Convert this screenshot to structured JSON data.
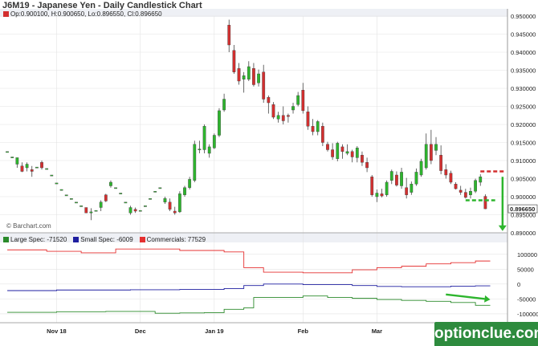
{
  "title": "J6M19 - Japanese Yen - Daily Candlestick Chart",
  "ohlc_text": "Op:0.900100, H:0.900650, Lo:0.896550, Cl:0.896650",
  "copyright": "© Barchart.com",
  "watermark": "optionclue.com",
  "last_price_label": "0.896650",
  "colors": {
    "up": "#2db52d",
    "down": "#d32f2f",
    "large": "#2a8a2a",
    "small": "#1f1fa0",
    "commercials": "#e53030",
    "accent": "#2e8b3e",
    "grid": "#e3e3e3"
  },
  "legend": [
    {
      "name": "Large Spec: -71520",
      "color": "#2a8a2a"
    },
    {
      "name": "Small Spec: -6009",
      "color": "#1f1fa0"
    },
    {
      "name": "Commercials: 77529",
      "color": "#e53030"
    }
  ],
  "chart_data": [
    {
      "type": "candlestick",
      "title": "J6M19 - Japanese Yen - Daily Candlestick Chart",
      "ylim": [
        0.89,
        0.95
      ],
      "yticks": [
        "0.950000",
        "0.945000",
        "0.940000",
        "0.935000",
        "0.930000",
        "0.925000",
        "0.920000",
        "0.915000",
        "0.910000",
        "0.905000",
        "0.900000",
        "0.895000",
        "0.890000"
      ],
      "yticks_values": [
        0.95,
        0.945,
        0.94,
        0.935,
        0.93,
        0.925,
        0.92,
        0.915,
        0.91,
        0.905,
        0.9,
        0.895,
        0.89
      ],
      "xticks": [
        "Nov 18",
        "Dec",
        "Jan 19",
        "Feb",
        "Mar"
      ],
      "xtick_index": [
        10,
        27,
        42,
        60,
        75
      ],
      "num_bars": 102,
      "candles": [
        {
          "i": 0,
          "o": 0.9125,
          "h": 0.9125,
          "l": 0.9125,
          "c": 0.9125
        },
        {
          "i": 1,
          "o": 0.911,
          "h": 0.911,
          "l": 0.911,
          "c": 0.911
        },
        {
          "i": 2,
          "o": 0.909,
          "h": 0.9105,
          "l": 0.908,
          "c": 0.9108
        },
        {
          "i": 3,
          "o": 0.9085,
          "h": 0.9095,
          "l": 0.9068,
          "c": 0.907
        },
        {
          "i": 4,
          "o": 0.908,
          "h": 0.9095,
          "l": 0.907,
          "c": 0.909
        },
        {
          "i": 5,
          "o": 0.9075,
          "h": 0.9085,
          "l": 0.9055,
          "c": 0.907
        },
        {
          "i": 6,
          "o": 0.9082,
          "h": 0.9082,
          "l": 0.9082,
          "c": 0.9082
        },
        {
          "i": 7,
          "o": 0.9095,
          "h": 0.91,
          "l": 0.9075,
          "c": 0.908
        },
        {
          "i": 8,
          "o": 0.9078,
          "h": 0.9078,
          "l": 0.9078,
          "c": 0.9078
        },
        {
          "i": 9,
          "o": 0.906,
          "h": 0.906,
          "l": 0.906,
          "c": 0.906
        },
        {
          "i": 10,
          "o": 0.9038,
          "h": 0.9038,
          "l": 0.9038,
          "c": 0.9038
        },
        {
          "i": 11,
          "o": 0.902,
          "h": 0.902,
          "l": 0.902,
          "c": 0.902
        },
        {
          "i": 12,
          "o": 0.9005,
          "h": 0.9005,
          "l": 0.9005,
          "c": 0.9005
        },
        {
          "i": 13,
          "o": 0.8995,
          "h": 0.8995,
          "l": 0.8995,
          "c": 0.8995
        },
        {
          "i": 14,
          "o": 0.8985,
          "h": 0.8985,
          "l": 0.8985,
          "c": 0.8985
        },
        {
          "i": 15,
          "o": 0.8975,
          "h": 0.8975,
          "l": 0.8975,
          "c": 0.8975
        },
        {
          "i": 16,
          "o": 0.897,
          "h": 0.897,
          "l": 0.8955,
          "c": 0.8955
        },
        {
          "i": 17,
          "o": 0.8955,
          "h": 0.8968,
          "l": 0.8935,
          "c": 0.8958
        },
        {
          "i": 18,
          "o": 0.8962,
          "h": 0.8962,
          "l": 0.8962,
          "c": 0.8962
        },
        {
          "i": 19,
          "o": 0.897,
          "h": 0.899,
          "l": 0.896,
          "c": 0.8985
        },
        {
          "i": 20,
          "o": 0.9005,
          "h": 0.9008,
          "l": 0.8985,
          "c": 0.8988
        },
        {
          "i": 21,
          "o": 0.903,
          "h": 0.9045,
          "l": 0.9025,
          "c": 0.904
        },
        {
          "i": 22,
          "o": 0.9025,
          "h": 0.9025,
          "l": 0.9025,
          "c": 0.9025
        },
        {
          "i": 23,
          "o": 0.901,
          "h": 0.901,
          "l": 0.901,
          "c": 0.901
        },
        {
          "i": 24,
          "o": 0.8985,
          "h": 0.8985,
          "l": 0.8985,
          "c": 0.8985
        },
        {
          "i": 25,
          "o": 0.8955,
          "h": 0.8975,
          "l": 0.895,
          "c": 0.897
        },
        {
          "i": 26,
          "o": 0.8965,
          "h": 0.897,
          "l": 0.8955,
          "c": 0.896
        },
        {
          "i": 27,
          "o": 0.8962,
          "h": 0.8962,
          "l": 0.8962,
          "c": 0.8962
        },
        {
          "i": 28,
          "o": 0.8975,
          "h": 0.8975,
          "l": 0.8975,
          "c": 0.8975
        },
        {
          "i": 29,
          "o": 0.8995,
          "h": 0.8995,
          "l": 0.8995,
          "c": 0.8995
        },
        {
          "i": 30,
          "o": 0.9015,
          "h": 0.9015,
          "l": 0.9015,
          "c": 0.9015
        },
        {
          "i": 31,
          "o": 0.9025,
          "h": 0.9025,
          "l": 0.9025,
          "c": 0.9025
        },
        {
          "i": 32,
          "o": 0.8985,
          "h": 0.9,
          "l": 0.898,
          "c": 0.8995
        },
        {
          "i": 33,
          "o": 0.8985,
          "h": 0.8995,
          "l": 0.896,
          "c": 0.8965
        },
        {
          "i": 34,
          "o": 0.896,
          "h": 0.8972,
          "l": 0.895,
          "c": 0.8955
        },
        {
          "i": 35,
          "o": 0.8958,
          "h": 0.9015,
          "l": 0.8955,
          "c": 0.9008
        },
        {
          "i": 36,
          "o": 0.9005,
          "h": 0.903,
          "l": 0.9,
          "c": 0.9025
        },
        {
          "i": 37,
          "o": 0.9025,
          "h": 0.9055,
          "l": 0.902,
          "c": 0.9048
        },
        {
          "i": 38,
          "o": 0.9045,
          "h": 0.9155,
          "l": 0.904,
          "c": 0.9145
        },
        {
          "i": 39,
          "o": 0.9132,
          "h": 0.9155,
          "l": 0.912,
          "c": 0.9132
        },
        {
          "i": 40,
          "o": 0.913,
          "h": 0.92,
          "l": 0.912,
          "c": 0.9195
        },
        {
          "i": 41,
          "o": 0.912,
          "h": 0.9145,
          "l": 0.9108,
          "c": 0.9138
        },
        {
          "i": 42,
          "o": 0.9135,
          "h": 0.9175,
          "l": 0.9132,
          "c": 0.917
        },
        {
          "i": 43,
          "o": 0.917,
          "h": 0.9245,
          "l": 0.9165,
          "c": 0.9238
        },
        {
          "i": 44,
          "o": 0.924,
          "h": 0.9285,
          "l": 0.9235,
          "c": 0.927
        },
        {
          "i": 45,
          "o": 0.9475,
          "h": 0.949,
          "l": 0.94,
          "c": 0.942
        },
        {
          "i": 46,
          "o": 0.9405,
          "h": 0.942,
          "l": 0.934,
          "c": 0.9345
        },
        {
          "i": 47,
          "o": 0.9355,
          "h": 0.937,
          "l": 0.931,
          "c": 0.932
        },
        {
          "i": 48,
          "o": 0.9325,
          "h": 0.9345,
          "l": 0.9288,
          "c": 0.9335
        },
        {
          "i": 49,
          "o": 0.9325,
          "h": 0.9375,
          "l": 0.932,
          "c": 0.936
        },
        {
          "i": 50,
          "o": 0.9355,
          "h": 0.937,
          "l": 0.9305,
          "c": 0.931
        },
        {
          "i": 51,
          "o": 0.9315,
          "h": 0.9352,
          "l": 0.9305,
          "c": 0.934
        },
        {
          "i": 52,
          "o": 0.9345,
          "h": 0.9365,
          "l": 0.926,
          "c": 0.927
        },
        {
          "i": 53,
          "o": 0.9275,
          "h": 0.928,
          "l": 0.923,
          "c": 0.926
        },
        {
          "i": 54,
          "o": 0.9255,
          "h": 0.9262,
          "l": 0.9215,
          "c": 0.922
        },
        {
          "i": 55,
          "o": 0.9215,
          "h": 0.9235,
          "l": 0.9205,
          "c": 0.9225
        },
        {
          "i": 56,
          "o": 0.9225,
          "h": 0.925,
          "l": 0.92,
          "c": 0.921
        },
        {
          "i": 57,
          "o": 0.9225,
          "h": 0.923,
          "l": 0.9205,
          "c": 0.9222
        },
        {
          "i": 58,
          "o": 0.924,
          "h": 0.926,
          "l": 0.923,
          "c": 0.925
        },
        {
          "i": 59,
          "o": 0.9255,
          "h": 0.929,
          "l": 0.925,
          "c": 0.928
        },
        {
          "i": 60,
          "o": 0.9295,
          "h": 0.9315,
          "l": 0.923,
          "c": 0.9238
        },
        {
          "i": 61,
          "o": 0.9235,
          "h": 0.925,
          "l": 0.9185,
          "c": 0.9195
        },
        {
          "i": 62,
          "o": 0.9195,
          "h": 0.9215,
          "l": 0.917,
          "c": 0.918
        },
        {
          "i": 63,
          "o": 0.918,
          "h": 0.9212,
          "l": 0.917,
          "c": 0.9208
        },
        {
          "i": 64,
          "o": 0.9195,
          "h": 0.9205,
          "l": 0.914,
          "c": 0.915
        },
        {
          "i": 65,
          "o": 0.9145,
          "h": 0.9152,
          "l": 0.9125,
          "c": 0.913
        },
        {
          "i": 66,
          "o": 0.913,
          "h": 0.9148,
          "l": 0.9102,
          "c": 0.911
        },
        {
          "i": 67,
          "o": 0.9105,
          "h": 0.9152,
          "l": 0.9098,
          "c": 0.9148
        },
        {
          "i": 68,
          "o": 0.9138,
          "h": 0.9145,
          "l": 0.9105,
          "c": 0.9125
        },
        {
          "i": 69,
          "o": 0.912,
          "h": 0.9145,
          "l": 0.9115,
          "c": 0.9125
        },
        {
          "i": 70,
          "o": 0.9125,
          "h": 0.913,
          "l": 0.9095,
          "c": 0.911
        },
        {
          "i": 71,
          "o": 0.9108,
          "h": 0.914,
          "l": 0.9095,
          "c": 0.9135
        },
        {
          "i": 72,
          "o": 0.9115,
          "h": 0.9125,
          "l": 0.9085,
          "c": 0.9095
        },
        {
          "i": 73,
          "o": 0.9095,
          "h": 0.9108,
          "l": 0.9068,
          "c": 0.908
        },
        {
          "i": 74,
          "o": 0.9055,
          "h": 0.906,
          "l": 0.9,
          "c": 0.9005
        },
        {
          "i": 75,
          "o": 0.9,
          "h": 0.902,
          "l": 0.8985,
          "c": 0.901
        },
        {
          "i": 76,
          "o": 0.9008,
          "h": 0.9022,
          "l": 0.8998,
          "c": 0.9002
        },
        {
          "i": 77,
          "o": 0.9005,
          "h": 0.9045,
          "l": 0.9,
          "c": 0.904
        },
        {
          "i": 78,
          "o": 0.9045,
          "h": 0.9075,
          "l": 0.9035,
          "c": 0.907
        },
        {
          "i": 79,
          "o": 0.906,
          "h": 0.907,
          "l": 0.9028,
          "c": 0.9032
        },
        {
          "i": 80,
          "o": 0.903,
          "h": 0.908,
          "l": 0.9022,
          "c": 0.9068
        },
        {
          "i": 81,
          "o": 0.9025,
          "h": 0.9052,
          "l": 0.8995,
          "c": 0.9005
        },
        {
          "i": 82,
          "o": 0.9012,
          "h": 0.9042,
          "l": 0.9005,
          "c": 0.9035
        },
        {
          "i": 83,
          "o": 0.9035,
          "h": 0.9078,
          "l": 0.903,
          "c": 0.9068
        },
        {
          "i": 84,
          "o": 0.906,
          "h": 0.9105,
          "l": 0.9055,
          "c": 0.9098
        },
        {
          "i": 85,
          "o": 0.908,
          "h": 0.9175,
          "l": 0.9075,
          "c": 0.9145
        },
        {
          "i": 86,
          "o": 0.9145,
          "h": 0.9185,
          "l": 0.909,
          "c": 0.91
        },
        {
          "i": 87,
          "o": 0.9128,
          "h": 0.9165,
          "l": 0.9115,
          "c": 0.9145
        },
        {
          "i": 88,
          "o": 0.9115,
          "h": 0.9142,
          "l": 0.9062,
          "c": 0.9072
        },
        {
          "i": 89,
          "o": 0.9075,
          "h": 0.909,
          "l": 0.905,
          "c": 0.906
        },
        {
          "i": 90,
          "o": 0.9065,
          "h": 0.9072,
          "l": 0.9035,
          "c": 0.904
        },
        {
          "i": 91,
          "o": 0.9035,
          "h": 0.904,
          "l": 0.902,
          "c": 0.9022
        },
        {
          "i": 92,
          "o": 0.9018,
          "h": 0.903,
          "l": 0.9005,
          "c": 0.9012
        },
        {
          "i": 93,
          "o": 0.9012,
          "h": 0.9022,
          "l": 0.8995,
          "c": 0.8998
        },
        {
          "i": 94,
          "o": 0.9005,
          "h": 0.9025,
          "l": 0.8995,
          "c": 0.9015
        },
        {
          "i": 95,
          "o": 0.9015,
          "h": 0.905,
          "l": 0.901,
          "c": 0.9045
        },
        {
          "i": 96,
          "o": 0.904,
          "h": 0.9062,
          "l": 0.903,
          "c": 0.9055
        },
        {
          "i": 97,
          "o": 0.9001,
          "h": 0.90065,
          "l": 0.89655,
          "c": 0.89665
        }
      ],
      "annotations": [
        {
          "type": "dashed-level",
          "color": "#d32f2f",
          "y": 0.907,
          "x_from": 96,
          "x_to": 101
        },
        {
          "type": "dashed-level",
          "color": "#2db52d",
          "y": 0.899,
          "x_from": 93,
          "x_to": 99
        },
        {
          "type": "arrow-down",
          "color": "#2db52d",
          "y_from": 0.9055,
          "y_to": 0.8905,
          "x": 100.5
        }
      ]
    },
    {
      "type": "line",
      "title": "",
      "ylim": [
        -130000,
        140000
      ],
      "yticks": [
        "100000",
        "50000",
        "0",
        "-50000",
        "-100000"
      ],
      "yticks_values": [
        100000,
        50000,
        0,
        -50000,
        -100000
      ],
      "series": [
        {
          "name": "Large Spec: -71520",
          "color": "#2a8a2a",
          "x": [
            0,
            10,
            10,
            20,
            20,
            30,
            30,
            35,
            35,
            40,
            40,
            44,
            44,
            48,
            48,
            50,
            50,
            60,
            60,
            65,
            65,
            70,
            70,
            75,
            75,
            80,
            80,
            85,
            85,
            90,
            90,
            95,
            95,
            98
          ],
          "values": [
            -95000,
            -95000,
            -93000,
            -93000,
            -92000,
            -92000,
            -98000,
            -98000,
            -97000,
            -97000,
            -96000,
            -96000,
            -85000,
            -85000,
            -80000,
            -80000,
            -45000,
            -45000,
            -40000,
            -40000,
            -45000,
            -45000,
            -48000,
            -48000,
            -52000,
            -52000,
            -55000,
            -55000,
            -58000,
            -58000,
            -62000,
            -62000,
            -71520,
            -71520
          ]
        },
        {
          "name": "Small Spec: -6009",
          "color": "#1f1fa0",
          "x": [
            0,
            10,
            10,
            25,
            25,
            35,
            35,
            44,
            44,
            48,
            48,
            52,
            52,
            60,
            60,
            70,
            70,
            75,
            75,
            80,
            80,
            90,
            90,
            95,
            95,
            98
          ],
          "values": [
            -22000,
            -22000,
            -20000,
            -20000,
            -19000,
            -19000,
            -18000,
            -18000,
            -15000,
            -15000,
            -5000,
            -5000,
            0,
            0,
            -2000,
            -2000,
            -5000,
            -5000,
            -8000,
            -8000,
            -9000,
            -9000,
            -7000,
            -7000,
            -6009,
            -6009
          ]
        },
        {
          "name": "Commercials: 77529",
          "color": "#e53030",
          "x": [
            0,
            8,
            8,
            15,
            15,
            22,
            22,
            35,
            35,
            44,
            44,
            48,
            48,
            52,
            52,
            60,
            60,
            70,
            70,
            75,
            75,
            80,
            80,
            85,
            85,
            90,
            90,
            95,
            95,
            98
          ],
          "values": [
            115000,
            115000,
            110000,
            110000,
            105000,
            105000,
            118000,
            118000,
            113000,
            113000,
            108000,
            108000,
            55000,
            55000,
            40000,
            40000,
            38000,
            38000,
            48000,
            48000,
            55000,
            55000,
            60000,
            60000,
            68000,
            68000,
            72000,
            72000,
            77529,
            77529
          ]
        }
      ],
      "annotations": [
        {
          "type": "arrow",
          "color": "#2db52d",
          "x_from": 89,
          "y_from": -35000,
          "x_to": 98,
          "y_to": -52000
        }
      ]
    }
  ]
}
